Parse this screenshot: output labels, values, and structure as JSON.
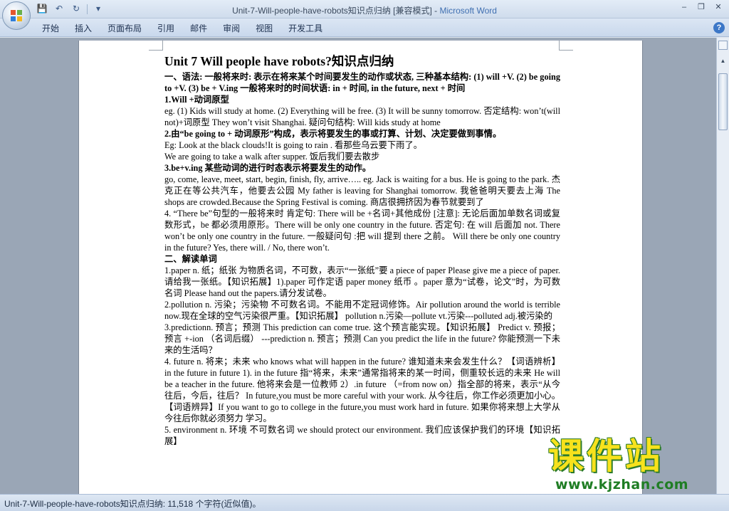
{
  "titlebar": {
    "doc_title": "Unit-7-Will-people-have-robots知识点归纳 [兼容模式] - ",
    "app_name": "Microsoft Word",
    "qat": {
      "save": "💾",
      "undo": "↶",
      "redo": "↻",
      "customize": "▾"
    },
    "controls": {
      "minimize": "–",
      "restore": "❐",
      "close": "✕"
    }
  },
  "ribbon": {
    "tabs": [
      "开始",
      "插入",
      "页面布局",
      "引用",
      "邮件",
      "审阅",
      "视图",
      "开发工具"
    ],
    "help": "?"
  },
  "doc": {
    "title": "Unit 7 Will people have robots?知识点归纳",
    "lines": [
      "一、语法: 一般将来时: 表示在将来某个时间要发生的动作或状态, 三种基本结构: (1) will +V. (2) be going to +V. (3) be + V.ing 一般将来时的时间状语: in + 时间, in the future, next + 时间",
      "1.Will +动词原型",
      "eg. (1) Kids will study at home. (2) Everything will be free. (3) It will be sunny tomorrow. 否定结构: won’t(will not)+词原型 They won’t visit Shanghai. 疑问句结构: Will kids study at home",
      "2.由“be going to + 动词原形”构成，表示将要发生的事或打算、计划、决定要做到事情。",
      "Eg: Look at the black clouds!It is going to rain . 看那些乌云要下雨了。",
      "We are going to take a walk after supper. 饭后我们要去散步",
      "3.be+v.ing 某些动词的进行时态表示将要发生的动作。",
      "go, come, leave, meet, start, begin, finish, fly, arrive….. eg. Jack is waiting for a bus. He is going to the park. 杰克正在等公共汽车，他要去公园 My father is leaving for Shanghai tomorrow. 我爸爸明天要去上海 The shops are crowded.Because the Spring Festival is coming. 商店很拥挤因为春节就要到了",
      "4. “There be”句型的一般将来时 肯定句: There will be +名词+其他成份 [注意]: 无论后面加单数名词或复数形式，be 都必须用原形。There will be only one country in the future. 否定句: 在 will 后面加 not. There won’t be only one country in the future. 一般疑问句 :把 will 提到 there 之前。 Will there be only one country in the future? Yes, there will. / No, there won’t.",
      "二、解读单词",
      "1.paper n. 纸；纸张 为物质名词，不可数，表示“一张纸”要 a piece of paper Please give me a piece of paper. 请给我一张纸。【知识拓展】1).paper 可作定语 paper money 纸币 。paper 意为“试卷，论文”时，为可数名词 Please hand out the papers.请分发试卷。",
      "2.pollution n. 污染；污染物 不可数名词。不能用不定冠词修饰。Air pollution around the world is terrible now.现在全球的空气污染很严重。【知识拓展】 pollution n.污染—pollute vt.污染---polluted adj.被污染的",
      "3.predictionn. 预言；预测 This prediction can come true. 这个预言能实现。【知识拓展】 Predict v. 预报；预言 +-ion （名词后缀） ---prediction n. 预言；预测 Can you predict the life in the future? 你能预测一下未来的生活吗？",
      "4. future n. 将来；未来 who knows what will happen in the future? 谁知道未来会发生什么？【词语辨析】in the future in future 1). in the future 指“将来，未来”通常指将来的某一时间，侧重较长远的未来 He will be a teacher in the future. 他将来会是一位教师 2）.in future （=from now on）指全部的将来，表示“从今往后，今后，往后？ In future,you must be more careful with your work. 从今往后，你工作必须更加小心。【词语辨异】If you want to go to college in the future,you must work hard in future. 如果你将来想上大学从今往后你就必须努力 学习。",
      "5. environment n. 环境 不可数名词 we should protect our environment. 我们应该保护我们的环境【知识拓展】"
    ]
  },
  "status": {
    "text": "Unit-7-Will-people-have-robots知识点归纳: 11,518 个字符(近似值)。"
  },
  "watermark": {
    "title": "课件站",
    "url": "www.kjzhan.com"
  },
  "colors": {
    "accent": "#3f6fb1",
    "watermark_yellow": "#f7e21c",
    "watermark_green": "#1f7d24"
  }
}
